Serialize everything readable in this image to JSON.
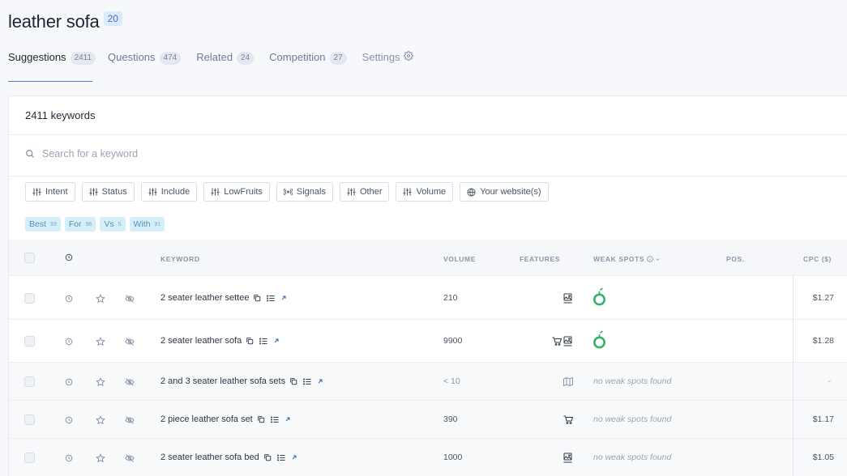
{
  "header": {
    "title": "leather sofa",
    "badge": "20"
  },
  "tabs": [
    {
      "label": "Suggestions",
      "count": "2411"
    },
    {
      "label": "Questions",
      "count": "474"
    },
    {
      "label": "Related",
      "count": "24"
    },
    {
      "label": "Competition",
      "count": "27"
    },
    {
      "label": "Settings"
    }
  ],
  "panel": {
    "keyword_count": "2411 keywords",
    "search_placeholder": "Search for a keyword",
    "filters": [
      "Intent",
      "Status",
      "Include",
      "LowFruits",
      "Signals",
      "Other",
      "Volume",
      "Your website(s)"
    ],
    "chips": [
      {
        "label": "Best",
        "count": "93"
      },
      {
        "label": "For",
        "count": "96"
      },
      {
        "label": "Vs",
        "count": "5"
      },
      {
        "label": "With",
        "count": "91"
      }
    ]
  },
  "table": {
    "headers": {
      "keyword": "KEYWORD",
      "volume": "VOLUME",
      "features": "FEATURES",
      "weak_spots": "WEAK SPOTS",
      "pos": "POS.",
      "cpc": "CPC ($)"
    },
    "rows": [
      {
        "keyword": "2 seater leather settee",
        "volume": "210",
        "features": [
          "image-icon"
        ],
        "weak": "",
        "cpc": "$1.27"
      },
      {
        "keyword": "2 seater leather sofa",
        "volume": "9900",
        "features": [
          "cart-icon",
          "image-icon"
        ],
        "weak": "",
        "cpc": "$1.28"
      },
      {
        "keyword": "2 and 3 seater leather sofa sets",
        "volume": "< 10",
        "features": [
          "map-icon"
        ],
        "weak": "no weak spots found",
        "cpc": "-"
      },
      {
        "keyword": "2 piece leather sofa set",
        "volume": "390",
        "features": [
          "cart-icon"
        ],
        "weak": "no weak spots found",
        "cpc": "$1.17"
      },
      {
        "keyword": "2 seater leather sofa bed",
        "volume": "1000",
        "features": [
          "image-icon"
        ],
        "weak": "no weak spots found",
        "cpc": "$1.05"
      }
    ]
  },
  "colors": {
    "accent": "#4f7cc7",
    "chip_bg": "#d6eef8",
    "weak_spot_green": "#2fb36b"
  }
}
